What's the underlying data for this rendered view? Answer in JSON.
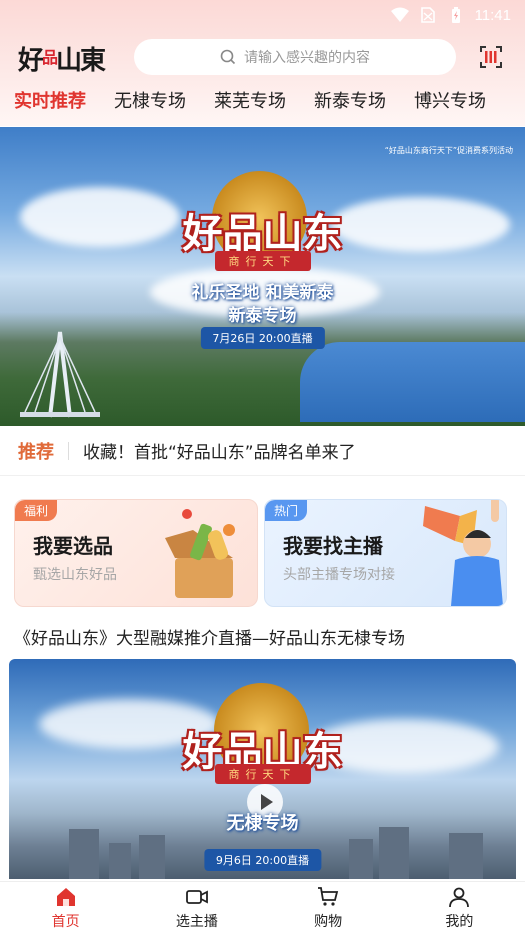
{
  "status_bar": {
    "time": "11:41"
  },
  "header": {
    "logo_main": "好",
    "logo_small": "品",
    "logo_end": "山東",
    "search_placeholder": "请输入感兴趣的内容"
  },
  "tabs": [
    {
      "label": "实时推荐",
      "active": true
    },
    {
      "label": "无棣专场",
      "active": false
    },
    {
      "label": "莱芜专场",
      "active": false
    },
    {
      "label": "新泰专场",
      "active": false
    },
    {
      "label": "博兴专场",
      "active": false
    }
  ],
  "banner": {
    "promo_text": "“好品山东商行天下”促消费系列活动",
    "brand_title": "好品山东",
    "brand_sub": "商行天下",
    "slogan_line1": "礼乐圣地 和美新泰",
    "slogan_line2": "新泰专场",
    "date": "7月26日  20:00直播"
  },
  "news": {
    "tag": "推荐",
    "text": "收藏！首批“好品山东”品牌名单来了"
  },
  "cards": [
    {
      "badge": "福利",
      "title": "我要选品",
      "sub": "甄选山东好品"
    },
    {
      "badge": "热门",
      "title": "我要找主播",
      "sub": "头部主播专场对接"
    }
  ],
  "live": {
    "title": "《好品山东》大型融媒推介直播—好品山东无棣专场",
    "brand_title": "好品山东",
    "brand_sub": "商行天下",
    "slogan": "无棣专场",
    "date": "9月6日 20:00直播"
  },
  "bottom_nav": [
    {
      "label": "首页",
      "icon": "home-icon",
      "active": true
    },
    {
      "label": "选主播",
      "icon": "video-camera-icon",
      "active": false
    },
    {
      "label": "购物",
      "icon": "cart-icon",
      "active": false
    },
    {
      "label": "我的",
      "icon": "user-icon",
      "active": false
    }
  ],
  "colors": {
    "accent": "#e0352f",
    "news_tag": "#e06a39",
    "badge_orange": "#f07b4f",
    "badge_blue": "#5897f0"
  }
}
